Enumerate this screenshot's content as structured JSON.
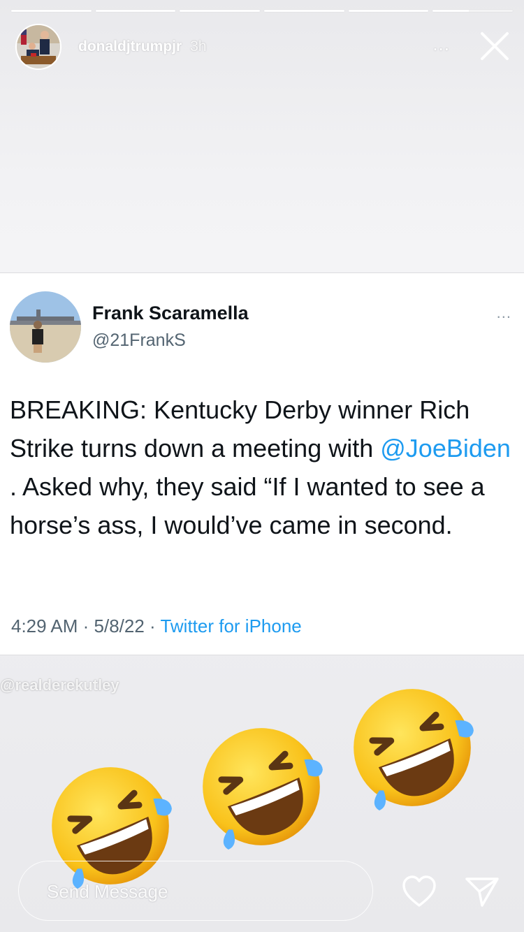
{
  "story": {
    "username": "donaldjtrumpjr",
    "time": "3h",
    "more_label": "...",
    "progress_segments": 6,
    "icons": [
      "avatar",
      "more-icon",
      "close-icon"
    ]
  },
  "tweet": {
    "name": "Frank Scaramella",
    "handle": "@21FrankS",
    "menu_label": "...",
    "text_part1": "BREAKING: Kentucky Derby winner Rich Strike turns down a meeting with ",
    "mention": "@JoeBiden",
    "text_part2": " . Asked why, they said “If I wanted to see a horse’s ass, I would’ve came in second.",
    "time": "4:29 AM",
    "date": "5/8/22",
    "source": "Twitter for iPhone",
    "separator": " · ",
    "colors": {
      "link": "#1d9bf0",
      "text": "#0f1419",
      "secondary": "#536471"
    }
  },
  "watermark": "@realderekutley",
  "stickers": {
    "icon": "rolling-on-floor-laughing-emoji",
    "count": 3
  },
  "reply": {
    "placeholder": "Send Message",
    "icons": [
      "heart-icon",
      "send-icon"
    ]
  }
}
